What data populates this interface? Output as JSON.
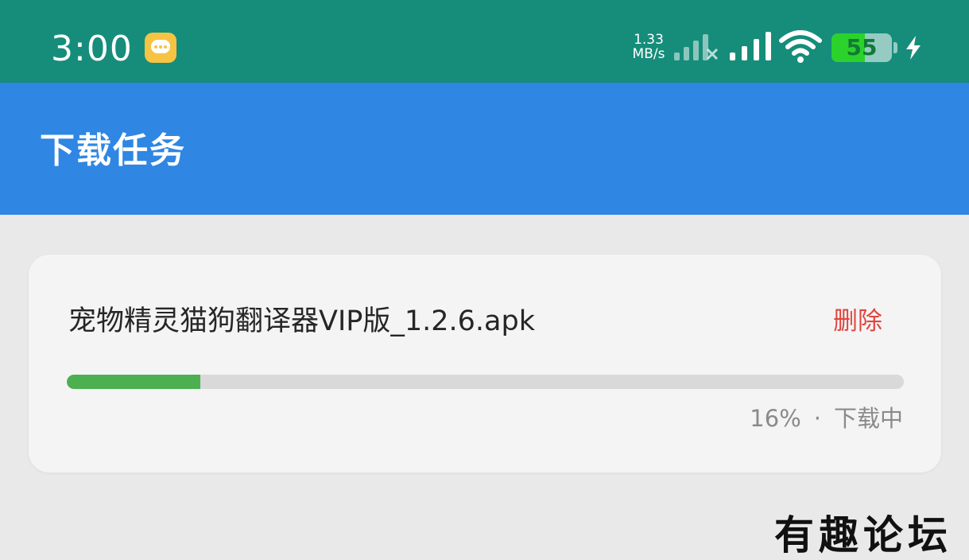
{
  "status_bar": {
    "time": "3:00",
    "notification_icon": "message-bubble-icon",
    "net_speed_value": "1.33",
    "net_speed_unit": "MB/s",
    "sim1_icon": "signal-weak-icon",
    "sim2_icon": "signal-full-icon",
    "wifi_icon": "wifi-icon",
    "battery_level": "55",
    "battery_fraction": 0.55,
    "charging_icon": "lightning-bolt-icon"
  },
  "app_bar": {
    "title": "下载任务"
  },
  "tasks": [
    {
      "file_name": "宠物精灵猫狗翻译器VIP版_1.2.6.apk",
      "delete_label": "删除",
      "progress_fraction": 0.16,
      "progress_text": "16%",
      "separator": "·",
      "status": "下载中"
    }
  ],
  "watermark": {
    "text": "有趣论坛"
  },
  "colors": {
    "status_bar": "#168d7a",
    "app_bar": "#2f86e3",
    "background": "#e9e9e9",
    "card": "#f4f4f4",
    "delete": "#e0463e",
    "progress": "#4caf50",
    "progress_track": "#d9d9d9",
    "battery_fill": "#2bd22b",
    "message_icon": "#f6c343"
  }
}
